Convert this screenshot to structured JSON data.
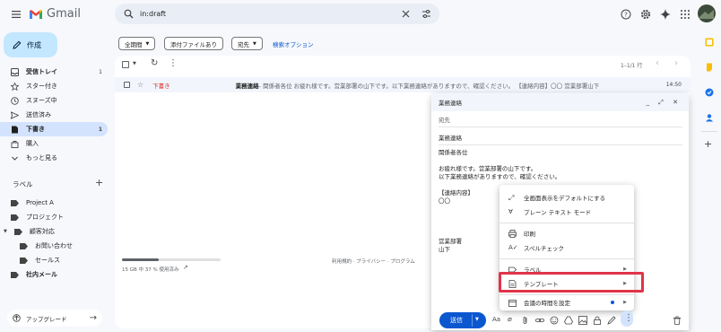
{
  "app": {
    "name": "Gmail"
  },
  "search": {
    "value": "in:draft"
  },
  "compose_label": "作成",
  "nav": [
    {
      "label": "受信トレイ",
      "count": "1",
      "icon": "inbox-icon"
    },
    {
      "label": "スター付き",
      "count": "",
      "icon": "star-icon"
    },
    {
      "label": "スヌーズ中",
      "count": "",
      "icon": "clock-icon"
    },
    {
      "label": "送信済み",
      "count": "",
      "icon": "send-icon"
    },
    {
      "label": "下書き",
      "count": "1",
      "icon": "draft-icon"
    },
    {
      "label": "購入",
      "count": "",
      "icon": "purchase-icon"
    },
    {
      "label": "もっと見る",
      "count": "",
      "icon": "chevron-down-icon"
    }
  ],
  "labels_heading": "ラベル",
  "labels": [
    {
      "label": "Project A",
      "indent": 0
    },
    {
      "label": "プロジェクト",
      "indent": 0
    },
    {
      "label": "顧客対応",
      "indent": 0
    },
    {
      "label": "お問い合わせ",
      "indent": 1
    },
    {
      "label": "セールス",
      "indent": 1
    },
    {
      "label": "社内メール",
      "indent": 0
    }
  ],
  "upgrade_label": "アップグレード",
  "filters": {
    "period": "全期間",
    "attachment": "添付ファイルあり",
    "to": "宛先",
    "search_options": "検索オプション"
  },
  "pagination": "1–1/1 行",
  "email": {
    "status": "下書き",
    "subject": "業務連絡",
    "snippet": " - 関係者各位 お疲れ様です。営業部署の山下です。以下業務連絡がありますので、確認ください。 【連絡内容】〇〇 営業部署山下",
    "date": "14:50"
  },
  "storage": {
    "text": "15 GB 中 37 % 使用済み",
    "fraction": 0.37
  },
  "footer": "利用規約 · プライバシー · プログラム",
  "popup": {
    "title": "業務連絡",
    "to_placeholder": "宛先",
    "subject": "業務連絡",
    "body": [
      "関係者各位",
      "",
      "お疲れ様です。営業部署の山下です。",
      "以下業務連絡がありますので、確認ください。",
      "",
      "【連絡内容】",
      "〇〇",
      "",
      "",
      "",
      "営業部署",
      "山下"
    ],
    "send_label": "送信"
  },
  "menu": [
    {
      "label": "全画面表示をデフォルトにする",
      "icon": "fullscreen-icon",
      "arrow": false
    },
    {
      "label": "プレーン テキスト モード",
      "icon": "plain-text-icon",
      "arrow": false
    },
    {
      "label": "印刷",
      "icon": "print-icon",
      "arrow": false
    },
    {
      "label": "スペルチェック",
      "icon": "spellcheck-icon",
      "arrow": false
    },
    {
      "label": "ラベル",
      "icon": "label-icon",
      "arrow": true
    },
    {
      "label": "テンプレート",
      "icon": "template-icon",
      "arrow": true
    },
    {
      "label": "会議の時間を設定",
      "icon": "calendar-icon",
      "arrow": true
    }
  ],
  "colors": {
    "accent": "#0b57d0",
    "highlight": "#e0344a",
    "active_nav": "#d3e3fd"
  }
}
